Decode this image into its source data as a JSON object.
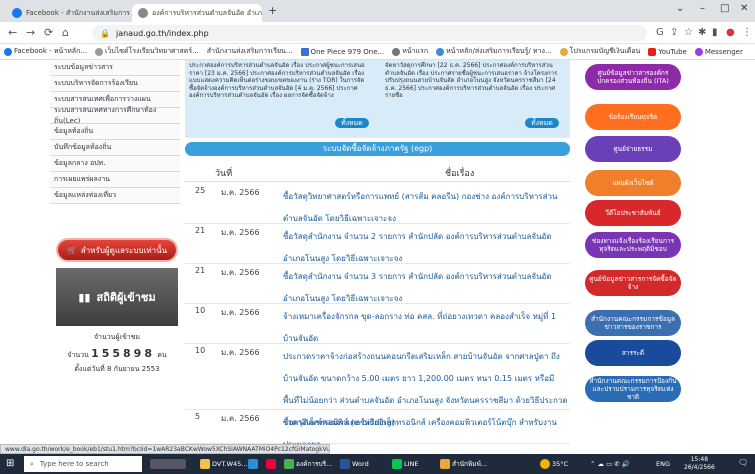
{
  "browser": {
    "tabs": [
      {
        "label": "Facebook - สำนักงานส่งเสริมการเรียนรู้...",
        "active": false
      },
      {
        "label": "องค์การบริหารส่วนตำบลจันอัด อำเภอโ",
        "active": true
      }
    ],
    "new_tab": "+",
    "url": "janaud.go.th/index.php",
    "bookmarks": [
      "Facebook - หน้าหลัก...",
      "เว็บไซต์โรงเรียนวิทยาศาสตร์...",
      "สำนักงานส่งเสริมการเรียน...",
      "One Piece 979 One...",
      "หน้าแรก",
      "หน้าหลัก/ส่งเสริมการเรียนรู้/ ทาง...",
      "โปรแกรมบัญชีเงินเดือน",
      "YouTube",
      "Messenger"
    ]
  },
  "left_menu": {
    "items": [
      "ระบบข้อมูลข่าวสาร",
      "ระบบบริหารจัดการร้องเรียน",
      "ระบบสารสนเทศเพื่อการวางแผน",
      "ระบบสารสนเทศทางการศึกษาท้องถิ่น(Lec)",
      "ข้อมูลท้องถิ่น",
      "บันทึกข้อมูลท้องถิ่น",
      "ข้อมูลกลาง อปท.",
      "การเผยแพร่ผลงาน",
      "ข้อมูลแหล่งท่องเที่ยว"
    ],
    "ticket_button": "สำหรับผู้ดูแลระบบเท่านั้น",
    "stats_title": "สถิติผู้เข้าชม",
    "stats_label": "จำนวนผู้เข้าชม",
    "stats_prefix": "จำนวน",
    "stats_count": "155898",
    "stats_suffix": "คน",
    "stats_since": "ตั้งแต่วันที่ 8 กันยายน 2553"
  },
  "news_panel": {
    "left_text": "ประกาศองค์การบริหารส่วนตำบลจันอัด เรื่อง ประกาศผู้ชนะการเสนอราคา [23 ม.ค. 2566] ประกาศองค์การบริหารส่วนตำบลจันอัด เรื่อง แบบแสดงความคิดเห็นต่อร่างขอบเขตของงาน (ร่าง TOR) ในการจัดซื้อจัดจ้างองค์การบริหารส่วนตำบลจันอัด [4 ม.ค. 2566] ประกาศองค์การบริหารส่วนตำบลจันอัด เรื่อง ผลการจัดซื้อจัดจ้าง",
    "right_text": "จัดหาวัสดุการศึกษา [22 ธ.ค. 2566] ประกาศองค์การบริหารส่วนตำบลจันอัด เรื่อง ประกาศรายชื่อผู้ชนะการเสนอราคา จ้างโครงการปรับปรุงถนนสายบ้านจันอัด อำเภอโนนสูง จังหวัดนครราชสีมา [24 ธ.ค. 2566] ประกาศองค์การบริหารส่วนตำบลจันอัด เรื่อง ประกาศรายชื่อ",
    "more_left": "ทั้งหมด",
    "more_right": "ทั้งหมด"
  },
  "procurement": {
    "title": "ระบบจัดซื้อจัดจ้างภาครัฐ (egp)",
    "col_date": "วันที่",
    "col_subject": "ชื่อเรื่อง",
    "rows": [
      {
        "num": "25",
        "date": "ม.ค. 2566",
        "title": "ซื้อวัสดุวิทยาศาสตร์หรือการแพทย์ (สารส้ม คลอรีน) กองช่าง องค์การบริหารส่วนตำบลจันอัด โดยวิธีเฉพาะเจาะจง"
      },
      {
        "num": "21",
        "date": "ม.ค. 2566",
        "title": "ซื้อวัสดุสำนักงาน จำนวน 2 รายการ สำนักปลัด องค์การบริหารส่วนตำบลจันอัด อำเภอโนนสูง โดยวิธีเฉพาะเจาะจง"
      },
      {
        "num": "21",
        "date": "ม.ค. 2566",
        "title": "ซื้อวัสดุสำนักงาน จำนวน 3 รายการ สำนักปลัด องค์การบริหารส่วนตำบลจันอัด อำเภอโนนสูง โดยวิธีเฉพาะเจาะจง"
      },
      {
        "num": "10",
        "date": "ม.ค. 2566",
        "title": "จ้างเหมาเครื่องจักรกล ขุด-ลอกราง ท่อ คสล. ที่ถ่อยางเทวดา คลองสำเร็จ หมู่ที่ 1 บ้านจันอัด"
      },
      {
        "num": "10",
        "date": "ม.ค. 2566",
        "title": "ประกวดราคาจ้างก่อสร้างถนนคอนกรีตเสริมเหล็ก สายบ้านจันอัด จากศาลปู่ตา ถึงบ้านจันอัด ขนาดกว้าง 5.00 เมตร ยาว 1,200.00 เมตร หนา 0.15 เมตร หรือมีพื้นที่ไม่น้อยกว่า ส่วนตำบลจันอัด อำเภอโนนสูง จังหวัดนครราชสีมา ด้วยวิธีประกวดราคาอิเล็กทรอนิกส์ (e-bidding)"
      },
      {
        "num": "5",
        "date": "ม.ค. 2566",
        "title": "ซื้อครุภัณฑ์คอมพิวเตอร์หรืออิเล็กทรอนิกส์ เครื่องคอมพิวเตอร์โน้ตบุ๊ก สำหรับงานประมวลผล"
      }
    ]
  },
  "right_banners": [
    {
      "label": "ศูนย์ข้อมูลข่าวสารองค์กรปกครองส่วนท้องถิ่น (ITA)",
      "color": "#8e2aa8"
    },
    {
      "label": "ข้อร้องเรียนทุจริต",
      "color": "#ff6f1f"
    },
    {
      "label": "ศูนย์จ่ายธรรม",
      "color": "#6a40b8"
    },
    {
      "label": "แผนผังเว็บไซต์",
      "color": "#ef7f2a"
    },
    {
      "label": "วีดีโอประชาสัมพันธ์",
      "color": "#d8282c"
    },
    {
      "label": "ช่องทางแจ้งเรื่องร้องเรียนการทุจริตและประพฤติมิชอบ",
      "color": "#7a35b5"
    },
    {
      "label": "ศูนย์ข้อมูลข่าวสารการจัดซื้อจัดจ้าง",
      "color": "#d22a2a"
    },
    {
      "label": "สำนักงานคณะกรรมการข้อมูลข่าวสารของราชการ",
      "color": "#3c6fb0"
    },
    {
      "label": "สารระดี",
      "color": "#1a4a9c"
    },
    {
      "label": "สำนักงานคณะกรรมการป้องกันและปราบปรามการทุจริตแห่งชาติ",
      "color": "#2a6cb5"
    }
  ],
  "status_link": "www.dla.go.th/work/e_book/eb1/stu1.htm?bcIid=1wAR23aBCKwWow5XChSIAWNAATMiO4Pc12cfGiMatogkVuUG2_ZrHQj2bw",
  "taskbar": {
    "search_placeholder": "Type here to search",
    "items": [
      "DVT.W45...",
      "องค์การบริ...",
      "Word",
      "LINE",
      "สำนักพิมพ์..."
    ],
    "temp": "35°C",
    "lang": "ENG",
    "time": "15:48",
    "date": "26/4/2566"
  }
}
